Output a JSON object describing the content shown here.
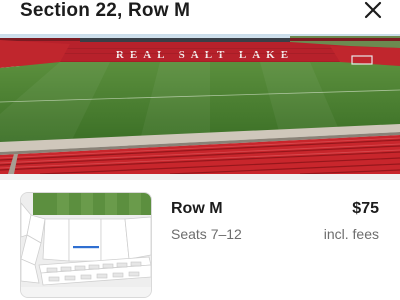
{
  "header": {
    "title": "Section 22, Row M",
    "close_icon": "close-icon"
  },
  "stadium_view": {
    "stand_lettering": "REAL SALT LAKE"
  },
  "listing": {
    "row": "Row M",
    "seats": "Seats 7–12",
    "price": "$75",
    "fees_note": "incl. fees"
  },
  "colors": {
    "seat_red": "#c8262c",
    "pitch_green": "#3f7a2c",
    "selected_row_blue": "#2f6fd1"
  }
}
